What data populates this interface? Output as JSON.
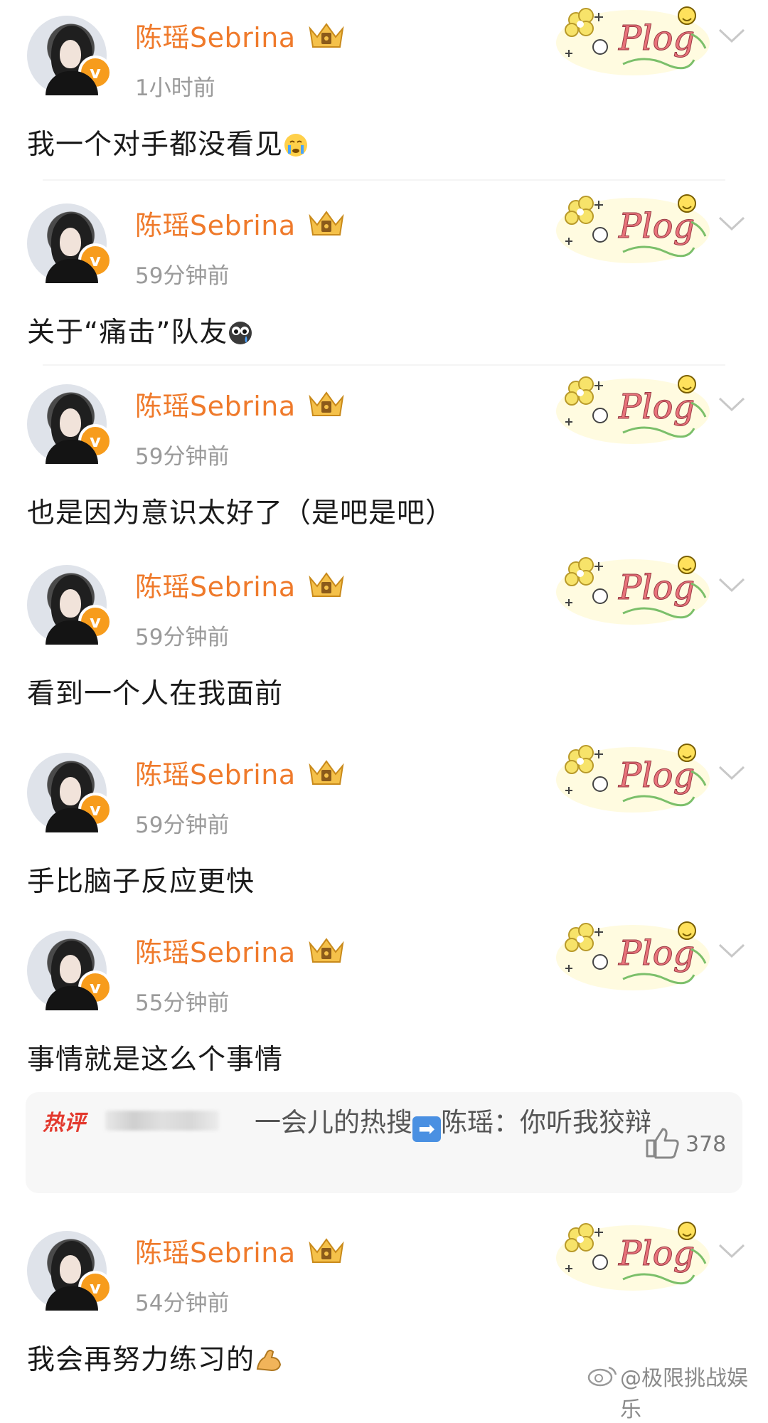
{
  "posts": [
    {
      "user": "陈瑶Sebrina",
      "time": "1小时前",
      "text": "我一个对手都没看见",
      "emoji": "crying-face"
    },
    {
      "user": "陈瑶Sebrina",
      "time": "59分钟前",
      "text": "关于“痛击”队友",
      "emoji": "teary-face"
    },
    {
      "user": "陈瑶Sebrina",
      "time": "59分钟前",
      "text": "也是因为意识太好了（是吧是吧）",
      "emoji": ""
    },
    {
      "user": "陈瑶Sebrina",
      "time": "59分钟前",
      "text": "看到一个人在我面前",
      "emoji": ""
    },
    {
      "user": "陈瑶Sebrina",
      "time": "59分钟前",
      "text": "手比脑子反应更快",
      "emoji": ""
    },
    {
      "user": "陈瑶Sebrina",
      "time": "55分钟前",
      "text": "事情就是这么个事情",
      "emoji": ""
    },
    {
      "user": "陈瑶Sebrina",
      "time": "54分钟前",
      "text": "我会再努力练习的",
      "emoji": "flexed-biceps"
    }
  ],
  "hot_comment": {
    "label": "热评",
    "text": "一会儿的热搜",
    "text2": "陈瑶：你听我狡辩",
    "likes": "378"
  },
  "badge_text": "v",
  "plog_label": "Plog",
  "watermark": "@极限挑战娱乐",
  "colors": {
    "username": "#ef7a2b",
    "badge": "#f79c1c",
    "hot_label": "#e33a2f"
  }
}
